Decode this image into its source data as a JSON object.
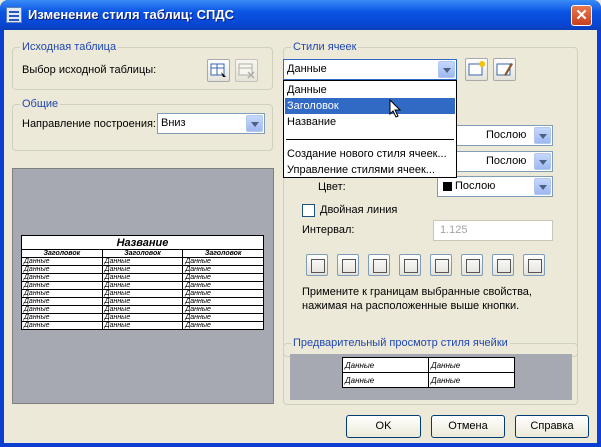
{
  "window": {
    "title": "Изменение стиля таблиц: СПДС"
  },
  "source_table": {
    "group_label": "Исходная таблица",
    "select_label": "Выбор исходной таблицы:"
  },
  "general": {
    "group_label": "Общие",
    "direction_label": "Направление построения:",
    "direction_value": "Вниз"
  },
  "cell_styles": {
    "group_label": "Стили ячеек",
    "selected": "Данные",
    "options": [
      "Данные",
      "Заголовок",
      "Название"
    ],
    "highlighted": "Заголовок",
    "actions": [
      "Создание нового стиля ячеек...",
      "Управление стилями ячеек..."
    ]
  },
  "borders": {
    "lineweight_value": "Послою",
    "linetype_value": "Послою",
    "color_label": "Цвет:",
    "color_value": "Послою",
    "color_swatch": "#000000",
    "double_line_label": "Двойная линия",
    "interval_label": "Интервал:",
    "interval_value": "1.125",
    "hint_line1": "Примените к границам выбранные свойства,",
    "hint_line2": "нажимая на расположенные выше кнопки.",
    "buttons": [
      "all-borders",
      "outside-borders",
      "inside-borders",
      "bottom-border",
      "left-border",
      "top-border",
      "right-border",
      "no-border"
    ]
  },
  "table_preview": {
    "title": "Название",
    "headers": [
      "Заголовок",
      "Заголовок",
      "Заголовок"
    ],
    "row_text": "Данные",
    "rows": 9
  },
  "cell_preview": {
    "group_label": "Предварительный просмотр стиля ячейки",
    "cells": [
      "Данные",
      "Данные",
      "Данные",
      "Данные"
    ]
  },
  "footer": {
    "ok": "OK",
    "cancel": "Отмена",
    "help": "Справка"
  }
}
